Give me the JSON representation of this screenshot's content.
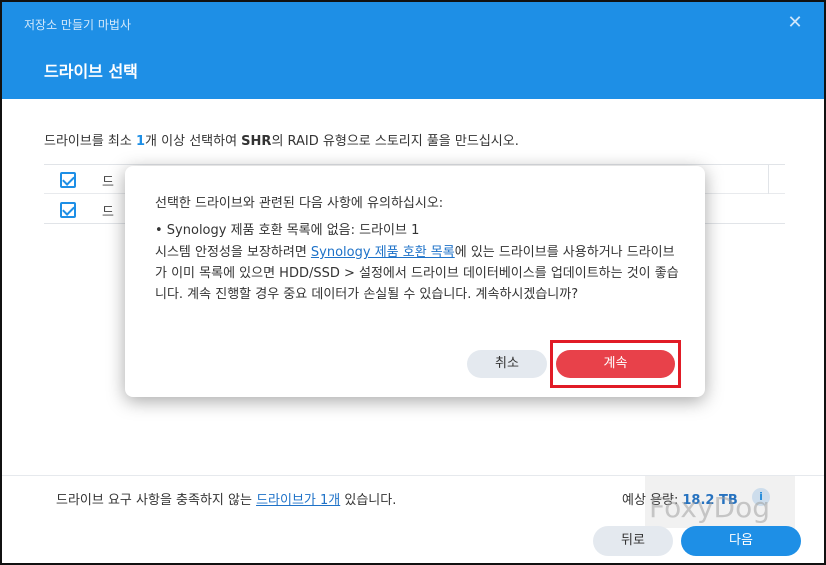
{
  "header": {
    "wizard_title": "저장소 만들기 마법사",
    "close_glyph": "✕",
    "step_title": "드라이브 선택"
  },
  "description": {
    "prefix": "드라이브를 최소 ",
    "count": "1",
    "middle": "개 이상 선택하여 ",
    "raid": "SHR",
    "suffix": "의 RAID 유형으로 스토리지 풀을 만드십시오."
  },
  "table": {
    "header_label": "드",
    "row_label": "드"
  },
  "dialog": {
    "title": "선택한 드라이브와 관련된 다음 사항에 유의하십시오:",
    "bullet": "• Synology 제품 호환 목록에 없음: 드라이브 1",
    "body_prefix": "시스템 안정성을 보장하려면 ",
    "body_link": "Synology 제품 호환 목록",
    "body_suffix": "에 있는 드라이브를 사용하거나 드라이브가 이미 목록에 있으면 HDD/SSD > 설정에서 드라이브 데이터베이스를 업데이트하는 것이 좋습니다. 계속 진행할 경우 중요 데이터가 손실될 수 있습니다. 계속하시겠습니까?",
    "cancel_label": "취소",
    "continue_label": "계속"
  },
  "footer": {
    "info_prefix": "드라이브 요구 사항을 충족하지 않는 ",
    "info_link": "드라이브가 1개",
    "info_suffix": " 있습니다.",
    "capacity_label": "예상 용량:",
    "capacity_value": "18.2 TB",
    "info_icon_glyph": "i",
    "watermark": "FoxyDog",
    "back_label": "뒤로",
    "next_label": "다음"
  },
  "colors": {
    "header_blue": "#1e8fe6",
    "continue_red": "#e8414a",
    "highlight_red": "#e11b26"
  }
}
